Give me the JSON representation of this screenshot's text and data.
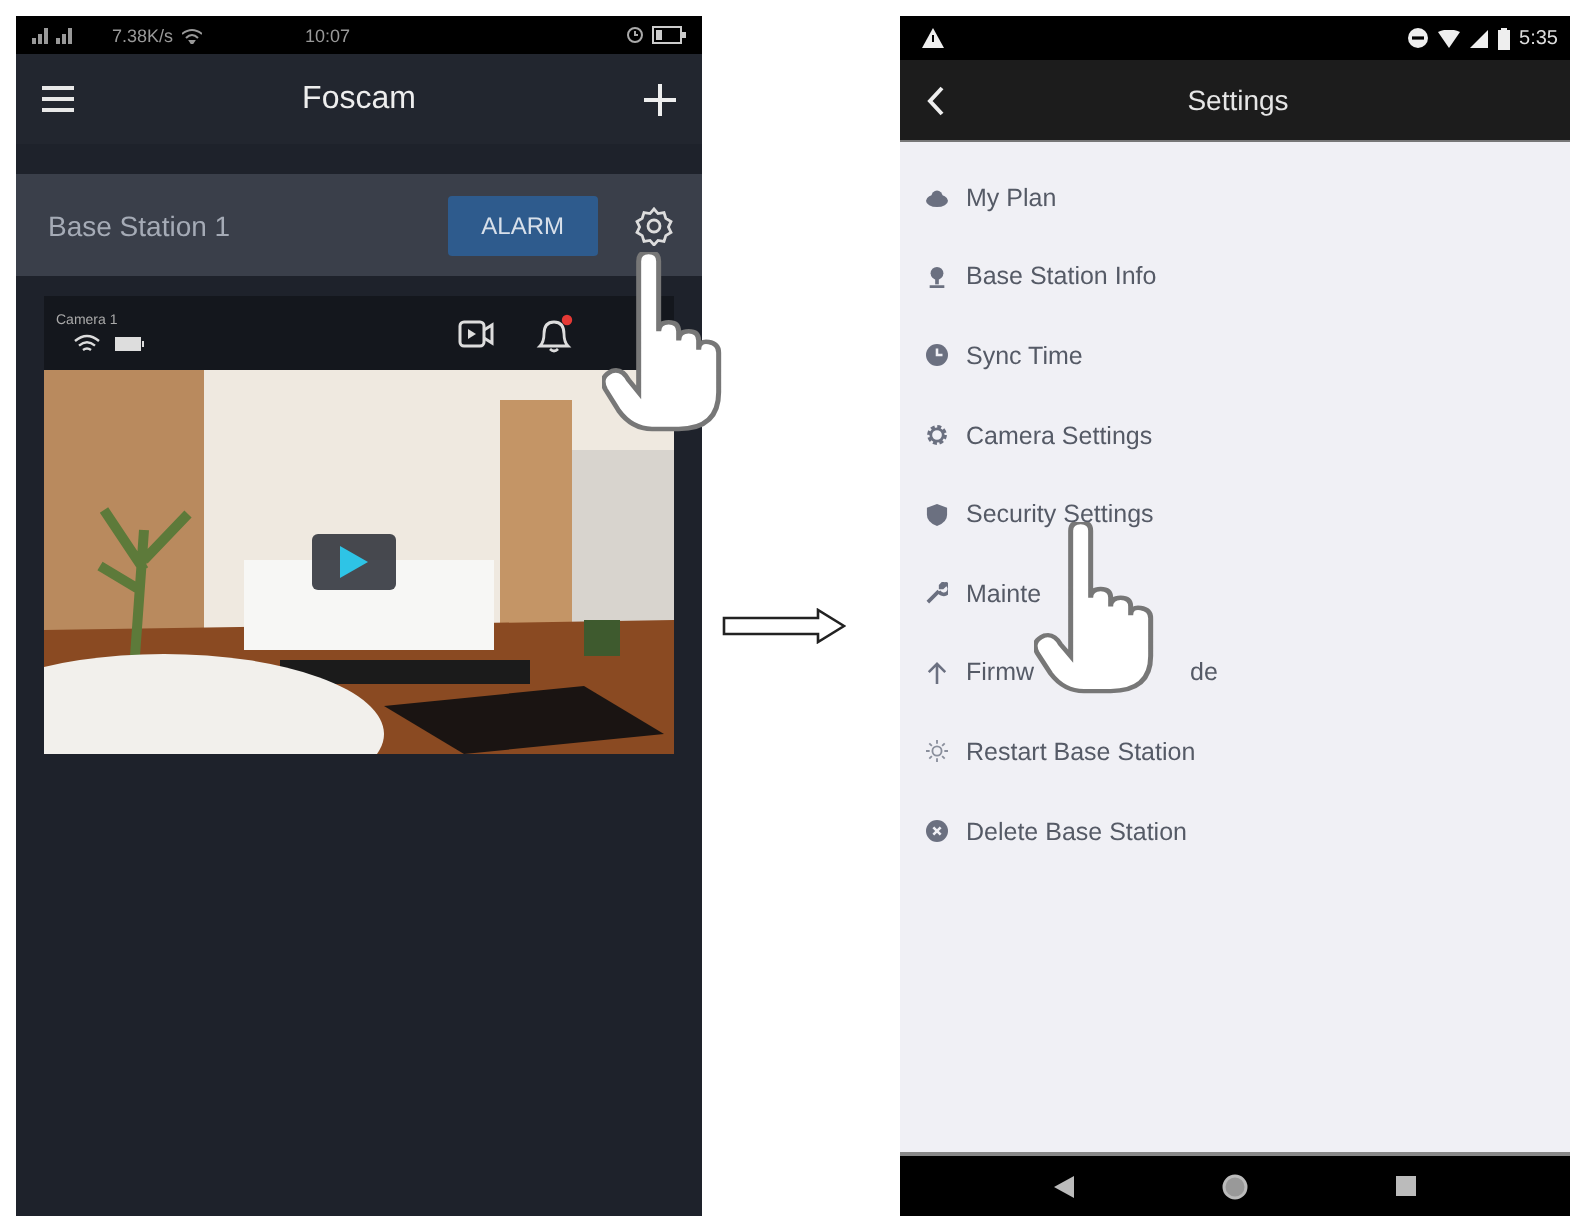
{
  "left_phone": {
    "status_bar": {
      "speed": "7.38K/s",
      "time": "10:07"
    },
    "title": "Foscam",
    "station": {
      "name": "Base Station 1",
      "alarm_button": "ALARM"
    },
    "camera": {
      "name": "Camera 1",
      "has_alert": true
    }
  },
  "right_phone": {
    "status_bar": {
      "time": "5:35"
    },
    "title": "Settings",
    "items": [
      {
        "kind": "cloud",
        "label": "My Plan"
      },
      {
        "kind": "pin",
        "label": "Base Station Info"
      },
      {
        "kind": "clock",
        "label": "Sync Time"
      },
      {
        "kind": "gear",
        "label": "Camera Settings"
      },
      {
        "kind": "shield",
        "label": "Security Settings"
      },
      {
        "kind": "wrench",
        "label": "Mainte"
      },
      {
        "kind": "arrow-up",
        "label": "Firmw",
        "label_tail": "de"
      },
      {
        "kind": "sun",
        "label": "Restart Base Station"
      },
      {
        "kind": "close",
        "label": "Delete Base Station"
      }
    ]
  }
}
